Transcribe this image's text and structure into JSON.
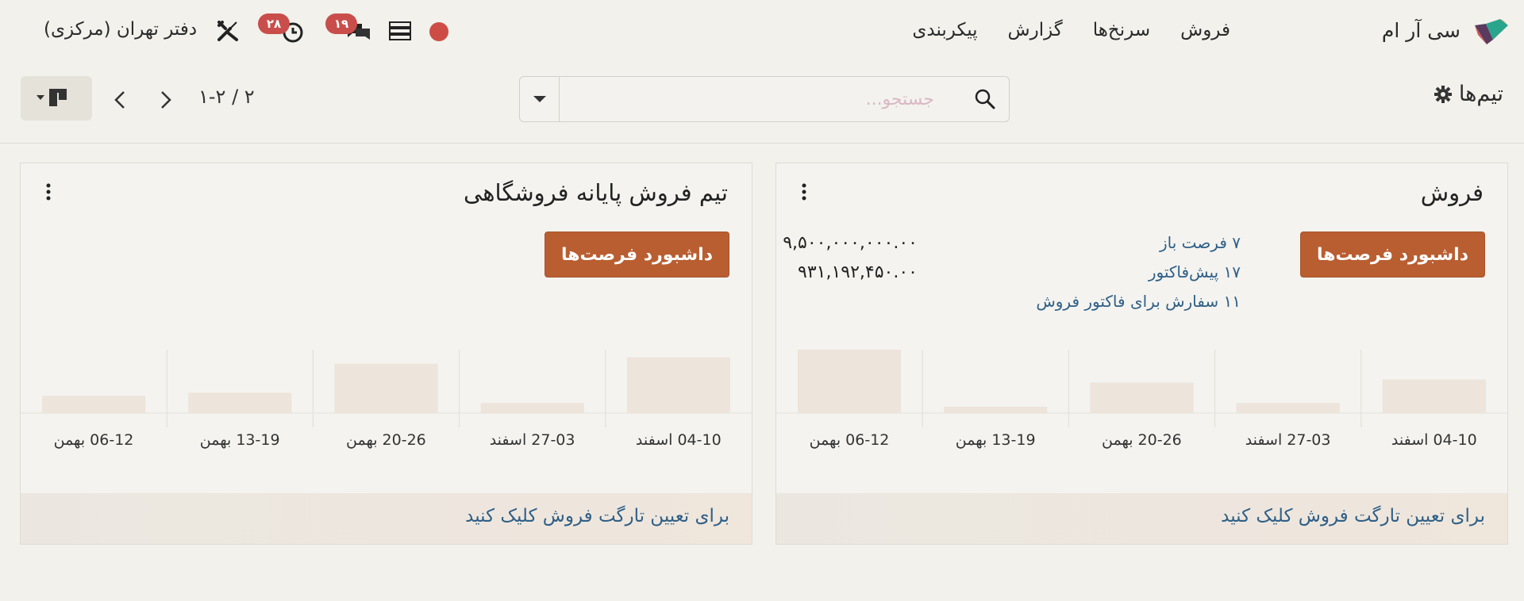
{
  "navbar": {
    "app_name": "سی آر ام",
    "menu": [
      "فروش",
      "سرنخ‌ها",
      "گزارش",
      "پیکربندی"
    ],
    "activity_count": "۲۸",
    "messages_count": "۱۹",
    "company": "دفتر تهران (مرکزی)"
  },
  "control": {
    "breadcrumb": "تیم‌ها",
    "search_placeholder": "جستجو...",
    "pager": "۱-۲ / ۲"
  },
  "cards": [
    {
      "title": "فروش",
      "button": "داشبورد فرصت‌ها",
      "links": [
        "۷ فرصت باز",
        "۱۷ پیش‌فاکتور",
        "۱۱ سفارش برای فاکتور فروش"
      ],
      "amounts": [
        "۹,۵۰۰,۰۰۰,۰۰۰.۰۰",
        "۹۳۱,۱۹۲,۴۵۰.۰۰"
      ],
      "footer": "برای تعیین تارگت فروش کلیک کنید",
      "chart_data": {
        "type": "bar",
        "categories": [
          "04-10 اسفند",
          "27-03 اسفند",
          "20-26 بهمن",
          "13-19 بهمن",
          "06-12 بهمن"
        ],
        "values": [
          0.53,
          0.16,
          0.48,
          0.1,
          1.0
        ],
        "ylim": [
          0,
          1
        ]
      }
    },
    {
      "title": "تیم فروش پایانه فروشگاهی",
      "button": "داشبورد فرصت‌ها",
      "links": [],
      "amounts": [],
      "footer": "برای تعیین تارگت فروش کلیک کنید",
      "chart_data": {
        "type": "bar",
        "categories": [
          "04-10 اسفند",
          "27-03 اسفند",
          "20-26 بهمن",
          "13-19 بهمن",
          "06-12 بهمن"
        ],
        "values": [
          0.88,
          0.16,
          0.78,
          0.32,
          0.27
        ],
        "ylim": [
          0,
          1
        ]
      }
    }
  ],
  "colors": {
    "accent_button": "#b95e31",
    "link": "#2f5f87",
    "badge": "#c94e4b",
    "bar": "#ede4db"
  }
}
